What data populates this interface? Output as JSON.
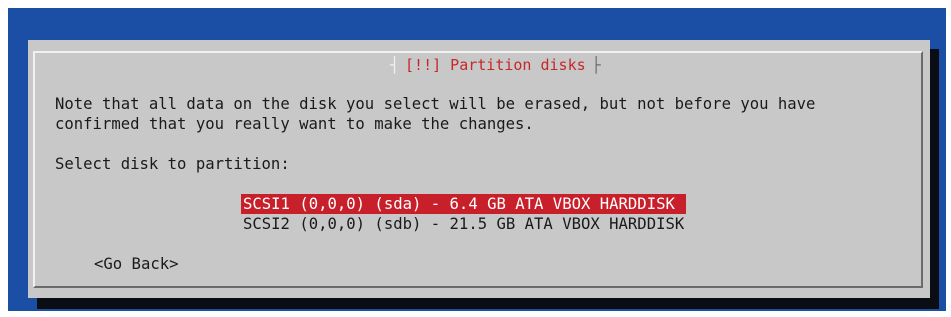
{
  "colors": {
    "background": "#1b4fa6",
    "dialog": "#c8c8c8",
    "selection": "#c8202a",
    "title_text": "#c62828"
  },
  "dialog": {
    "title": "[!!] Partition disks",
    "note_line_1": "Note that all data on the disk you select will be erased, but not before you have",
    "note_line_2": "confirmed that you really want to make the changes.",
    "prompt": "Select disk to partition:",
    "disks": [
      {
        "label": "SCSI1 (0,0,0) (sda) - 6.4 GB ATA VBOX HARDDISK",
        "selected": true
      },
      {
        "label": "SCSI2 (0,0,0) (sdb) - 21.5 GB ATA VBOX HARDDISK",
        "selected": false
      }
    ],
    "go_back_label": "<Go Back>"
  }
}
